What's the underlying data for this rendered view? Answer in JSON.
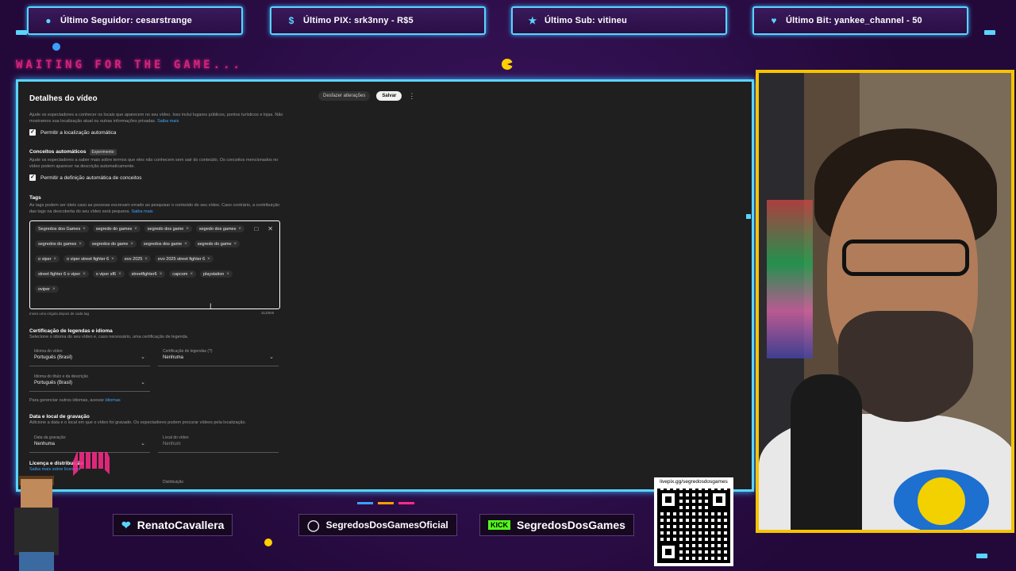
{
  "overlay": {
    "top_bars": [
      {
        "icon": "user-icon",
        "label": "Último Seguidor: cesarstrange"
      },
      {
        "icon": "dollar-icon",
        "label": "Último PIX: srk3nny - R$5"
      },
      {
        "icon": "star-icon",
        "label": "Último Sub: vitineu"
      },
      {
        "icon": "diamond-icon",
        "label": "Último Bit: yankee_channel - 50"
      }
    ],
    "waiting_text": "WAITING FOR THE GAME...",
    "socials": {
      "twitter": "RenatoCavallera",
      "instagram": "SegredosDosGamesOficial",
      "kick_badge": "KICK",
      "kick": "SegredosDosGames"
    },
    "qr_url": "livepix.gg/segredosdosgames",
    "colors": {
      "accent": "#5ad4ff",
      "cam_border": "#f5c400",
      "neon_pink": "#ff2a8a"
    }
  },
  "yt": {
    "title": "Detalhes do vídeo",
    "undo_label": "Desfazer alterações",
    "save_label": "Salvar",
    "location_desc": "Ajude os espectadores a conhecer os locais que aparecem no seu vídeo. Isso inclui lugares públicos, pontos turísticos e lojas. Não mostramos sua localização atual ou outras informações privadas.",
    "saiba_mais": "Saiba mais",
    "location_checkbox": "Permitir a localização automática",
    "concepts_title": "Conceitos automáticos",
    "concepts_badge": "Experimento",
    "concepts_desc": "Ajude os espectadores a saber mais sobre termos que eles não conhecem sem sair do conteúdo. Os conceitos mencionados no vídeo podem aparecer na descrição automaticamente.",
    "concepts_checkbox": "Permitir a definição automática de conceitos",
    "tags_title": "Tags",
    "tags_desc": "As tags podem ser úteis caso as pessoas escrevam errado ao pesquisar o conteúdo do seu vídeo. Caso contrário, a contribuição das tags na descoberta do seu vídeo será pequena.",
    "tags": [
      "Segredos dos Games",
      "segredo do games",
      "segredo dos game",
      "segedo dos games",
      "segredos do games",
      "segredos do game",
      "segredos dos game",
      "segredo do game",
      "o viper",
      "o viper street fighter 6",
      "evo 2025",
      "evo 2025 street fighter 6",
      "street fighter 6 o viper",
      "o viper sf6",
      "streetfighter6",
      "capcom",
      "playstation",
      "oviper"
    ],
    "tags_hint": "Insira uma vírgula depois de cada tag",
    "tags_counter": "313/500",
    "cert_title": "Certificação de legendas e idioma",
    "cert_desc": "Selecione o idioma do seu vídeo e, caso necessário, uma certificação de legenda.",
    "lang_label": "Idioma do vídeo",
    "lang_value": "Português (Brasil)",
    "cert_label": "Certificação de legendas (?)",
    "cert_value": "Nenhuma",
    "title_lang_label": "Idioma do título e da descrição",
    "title_lang_value": "Português (Brasil)",
    "other_langs": "Para gerenciar outros idiomas, acesse",
    "other_langs_link": "Idiomas",
    "date_title": "Data e local de gravação",
    "date_desc": "Adicione a data e o local em que o vídeo foi gravado. Os espectadores podem procurar vídeos pela localização.",
    "date_label": "Data da gravação",
    "date_value": "Nenhuma",
    "place_label": "Local do vídeo",
    "place_value": "Nenhum",
    "license_title": "Licença e distribuição",
    "license_desc": "Saiba mais sobre licenças",
    "distrib_label": "Distribuição"
  }
}
